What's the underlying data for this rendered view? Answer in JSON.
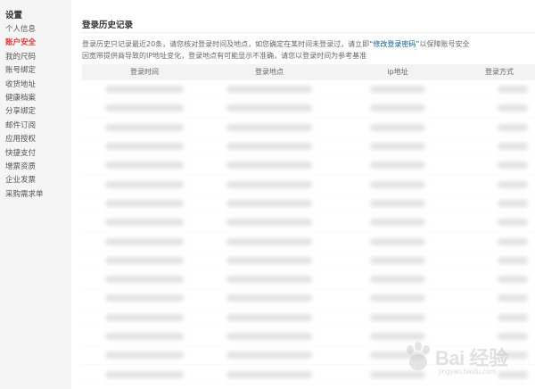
{
  "sidebar": {
    "title": "设置",
    "items": [
      {
        "label": "个人信息"
      },
      {
        "label": "账户安全"
      },
      {
        "label": "我的尺码"
      },
      {
        "label": "账号绑定"
      },
      {
        "label": "收货地址"
      },
      {
        "label": "健康档案"
      },
      {
        "label": "分享绑定"
      },
      {
        "label": "邮件订阅"
      },
      {
        "label": "应用授权"
      },
      {
        "label": "快捷支付"
      },
      {
        "label": "增票资质"
      },
      {
        "label": "企业发票"
      },
      {
        "label": "采购需求单"
      }
    ],
    "active_index": 1,
    "active_color": "#e4393c"
  },
  "main": {
    "title": "登录历史记录",
    "notice": {
      "line1_before": "登录历史只记录最近20条，请您核对登录时间及地点，如您确定在某时间未登录过，请立即",
      "link": "“修改登录密码”",
      "line1_after": "以保障账号安全",
      "line2": "因宽带提供商导致的IP地址变化，登录地点有可能显示不准确，请您以登录时间为参考基准",
      "link_color": "#005ea7"
    },
    "table": {
      "headers": [
        "登录时间",
        "登录地点",
        "ip地址",
        "登录方式"
      ],
      "rows_blurred": true,
      "row_count": 16
    }
  },
  "watermark": {
    "text": "Bai 经验",
    "url": "jingyan.baidu.com"
  }
}
